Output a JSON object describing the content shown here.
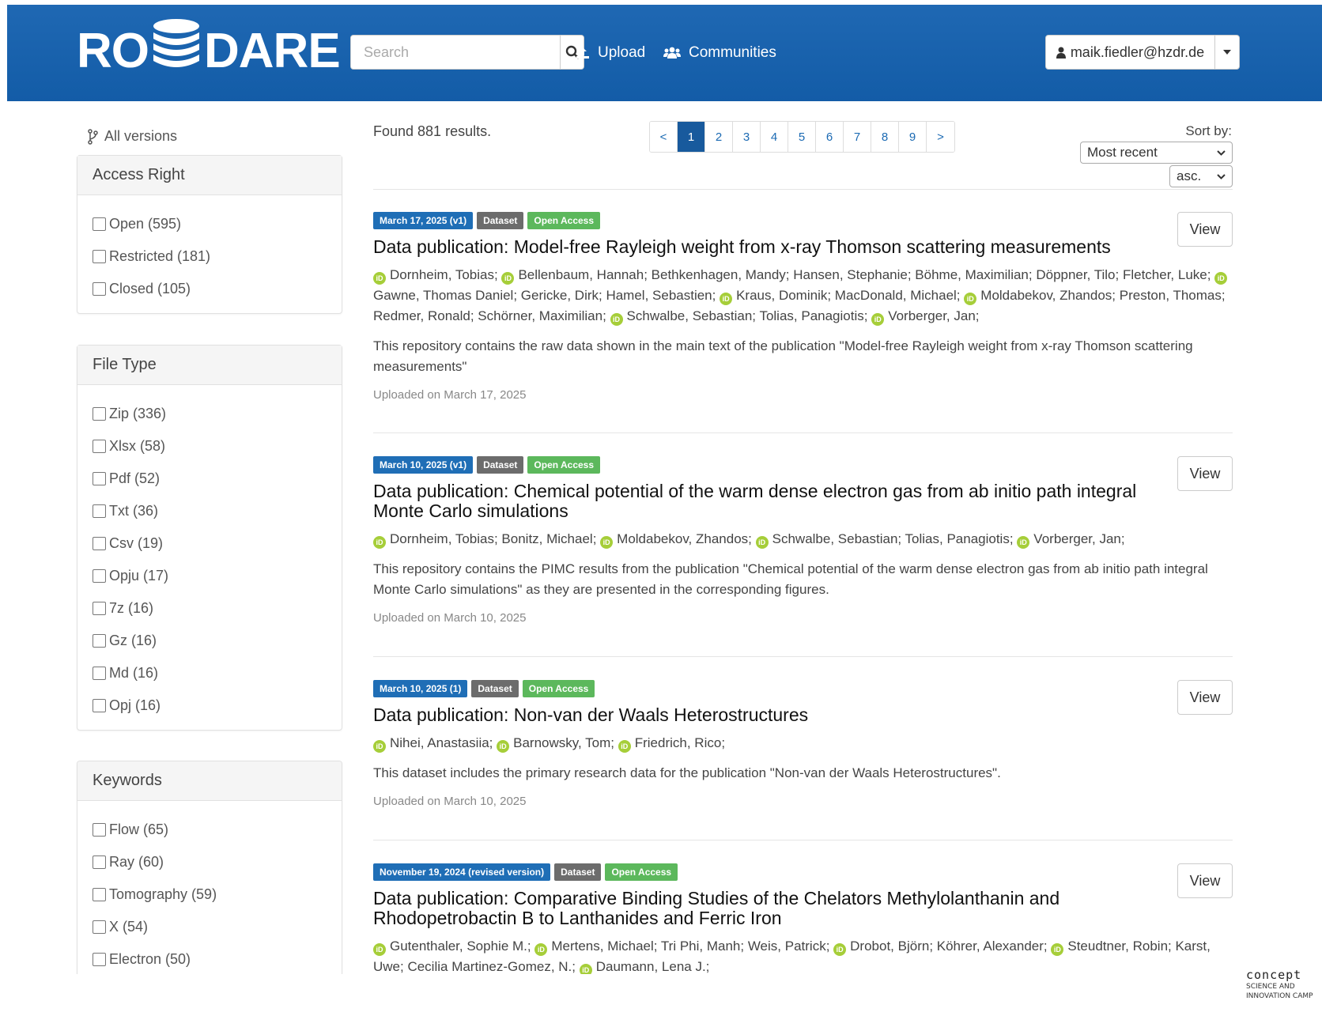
{
  "header": {
    "logo_left": "RO",
    "logo_right": "DARE",
    "search_placeholder": "Search",
    "upload_label": "Upload",
    "communities_label": "Communities",
    "user_email": "maik.fiedler@hzdr.de"
  },
  "sidebar": {
    "all_versions": "All versions",
    "access_right": {
      "title": "Access Right",
      "items": [
        "Open (595)",
        "Restricted (181)",
        "Closed (105)"
      ]
    },
    "file_type": {
      "title": "File Type",
      "items": [
        "Zip (336)",
        "Xlsx (58)",
        "Pdf (52)",
        "Txt (36)",
        "Csv (19)",
        "Opju (17)",
        "7z (16)",
        "Gz (16)",
        "Md (16)",
        "Opj (16)"
      ]
    },
    "keywords": {
      "title": "Keywords",
      "items": [
        "Flow (65)",
        "Ray (60)",
        "Tomography (59)",
        "X (54)",
        "Electron (50)"
      ]
    }
  },
  "results": {
    "found": "Found 881 results.",
    "pages": [
      "<",
      "1",
      "2",
      "3",
      "4",
      "5",
      "6",
      "7",
      "8",
      "9",
      ">"
    ],
    "active_page": "1",
    "sort_label": "Sort by:",
    "sort_value": "Most recent",
    "order_value": "asc."
  },
  "records": [
    {
      "date_badge": "March 17, 2025 (v1)",
      "type_badge": "Dataset",
      "access_badge": "Open Access",
      "title": "Data publication: Model-free Rayleigh weight from x-ray Thomson scattering measurements",
      "view": "View",
      "uploaded": "Uploaded on March 17, 2025",
      "description": "This repository contains the raw data shown in the main text of the publication \"Model-free Rayleigh weight from x-ray Thomson scattering measurements\""
    },
    {
      "date_badge": "March 10, 2025 (v1)",
      "type_badge": "Dataset",
      "access_badge": "Open Access",
      "title": "Data publication: Chemical potential of the warm dense electron gas from ab initio path integral Monte Carlo simulations",
      "view": "View",
      "uploaded": "Uploaded on March 10, 2025",
      "description": "This repository contains the PIMC results from the publication \"Chemical potential of the warm dense electron gas from ab initio path integral Monte Carlo simulations\" as they are presented in the corresponding figures."
    },
    {
      "date_badge": "March 10, 2025 (1)",
      "type_badge": "Dataset",
      "access_badge": "Open Access",
      "title": "Data publication: Non-van der Waals Heterostructures",
      "view": "View",
      "uploaded": "Uploaded on March 10, 2025",
      "description": "This dataset includes the primary research data for the publication \"Non-van der Waals Heterostructures\"."
    },
    {
      "date_badge": "November 19, 2024 (revised version)",
      "type_badge": "Dataset",
      "access_badge": "Open Access",
      "title": "Data publication: Comparative Binding Studies of the Chelators Methylolanthanin and Rhodopetrobactin B to Lanthanides and Ferric Iron",
      "view": "View"
    }
  ],
  "authors": {
    "r1": {
      "a1": "Dornheim, Tobias;",
      "a2": "Bellenbaum, Hannah; Bethkenhagen, Mandy; Hansen, Stephanie; Böhme, Maximilian; Döppner, Tilo; Fletcher, Luke;",
      "a3": "Gawne, Thomas Daniel; Gericke, Dirk; Hamel, Sebastien;",
      "a4": "Kraus, Dominik; MacDonald, Michael;",
      "a5": "Moldabekov, Zhandos; Preston, Thomas; Redmer, Ronald; Schörner, Maximilian;",
      "a6": "Schwalbe, Sebastian; Tolias, Panagiotis;",
      "a7": "Vorberger, Jan;"
    },
    "r2": {
      "a1": "Dornheim, Tobias; Bonitz, Michael;",
      "a2": "Moldabekov, Zhandos;",
      "a3": "Schwalbe, Sebastian; Tolias, Panagiotis;",
      "a4": "Vorberger, Jan;"
    },
    "r3": {
      "a1": "Nihei, Anastasiia;",
      "a2": "Barnowsky, Tom;",
      "a3": "Friedrich, Rico;"
    },
    "r4": {
      "a1": "Gutenthaler, Sophie M.;",
      "a2": "Mertens, Michael; Tri Phi, Manh; Weis, Patrick;",
      "a3": "Drobot, Björn; Köhrer, Alexander;",
      "a4": "Steudtner, Robin; Karst, Uwe; Cecilia Martinez-Gomez, N.;",
      "a5": "Daumann, Lena J.;"
    }
  },
  "orcid_mark": "iD",
  "footer_badge": {
    "brand": "concept",
    "line1": "SCIENCE AND",
    "line2": "INNOVATION CAMP"
  },
  "colors": {
    "header_bg": "#1663af",
    "badge_date": "#1f6eb6",
    "badge_type": "#6c6c6c",
    "badge_open": "#5cb85c",
    "orcid": "#a6ce39",
    "page_active": "#185a9d"
  }
}
